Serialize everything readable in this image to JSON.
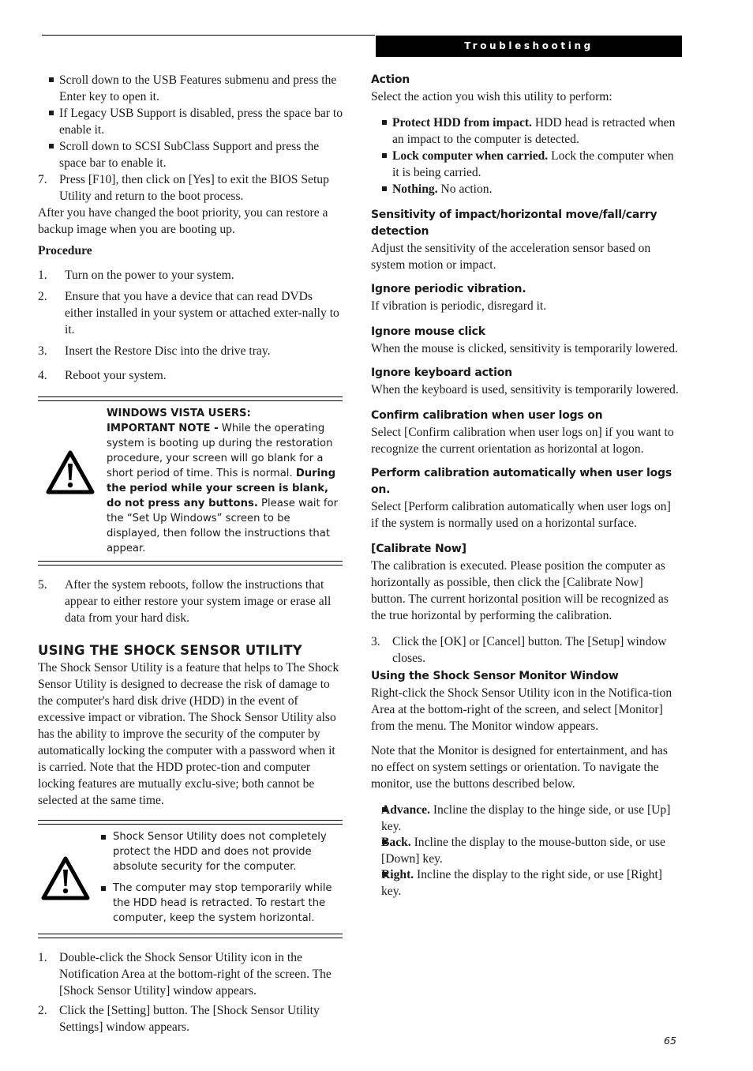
{
  "header": {
    "section_banner": "Troubleshooting"
  },
  "left": {
    "bios_bullets": [
      "Scroll down to the USB Features submenu and press the Enter key to open it.",
      "If Legacy USB Support is disabled, press the space bar to enable it.",
      "Scroll down to SCSI SubClass Support and press the space bar to enable it."
    ],
    "step7": {
      "num": "7.",
      "text": "Press [F10], then click on [Yes] to exit the BIOS Setup Utility and return to the boot process."
    },
    "after_text": "After you have changed the boot priority, you can restore a backup image when you are booting up.",
    "procedure_label": "Procedure",
    "procedure_steps": [
      {
        "num": "1.",
        "text": "Turn on the power to your system."
      },
      {
        "num": "2.",
        "text": "Ensure that you have a device that can read DVDs either installed in your system or attached exter-nally to it."
      },
      {
        "num": "3.",
        "text": "Insert the Restore Disc into the drive tray."
      },
      {
        "num": "4.",
        "text": "Reboot your system."
      }
    ],
    "vista_note": {
      "icon": "warning-icon",
      "heading": "WINDOWS VISTA USERS:",
      "lead_bold": "IMPORTANT NOTE -",
      "text1": " While the operating system is booting up during the restoration procedure, your screen will go blank for a short period of time. This is normal. ",
      "bold2": "During the period while your screen is blank, do not press any buttons.",
      "text2": " Please wait for the “Set Up Windows” screen to be displayed, then follow the instructions that appear."
    },
    "step5": {
      "num": "5.",
      "text": "After the system reboots, follow the instructions that appear to either restore your system image or erase all data from your hard disk."
    },
    "shock_title": "USING THE SHOCK SENSOR UTILITY",
    "shock_intro": "The Shock Sensor Utility is a feature that helps to The Shock Sensor Utility is designed to decrease the risk of damage to the computer's hard disk drive (HDD) in the event of excessive impact or vibration. The Shock Sensor Utility also has the ability to improve the security of the computer by automatically locking the computer with a password when it is carried. Note that the HDD protec-tion and computer locking features are mutually exclu-sive; both cannot be selected at the same time.",
    "shock_note": {
      "icon": "warning-icon",
      "bullets": [
        "Shock Sensor Utility does not completely protect the HDD and does not provide absolute security for the computer.",
        "The computer may stop temporarily while the HDD head is retracted. To restart the computer, keep the system horizontal."
      ]
    },
    "shock_steps": [
      {
        "num": "1.",
        "text": "Double-click the Shock Sensor Utility icon in the Notification Area at the bottom-right of the screen. The [Shock Sensor Utility] window appears."
      },
      {
        "num": "2.",
        "text": "Click the [Setting] button. The [Shock Sensor Utility Settings] window appears."
      }
    ]
  },
  "right": {
    "action_heading": "Action",
    "action_intro": "Select the action you wish this utility to perform:",
    "action_bullets": [
      {
        "bold": "Protect HDD from impact.",
        "text": " HDD head is retracted when an impact to the computer is detected."
      },
      {
        "bold": "Lock computer when carried.",
        "text": " Lock the computer when it is being carried."
      },
      {
        "bold": "Nothing.",
        "text": " No action."
      }
    ],
    "settings": [
      {
        "heading": "Sensitivity of impact/horizontal move/fall/carry detection",
        "text": "Adjust the sensitivity of the acceleration sensor based on system motion or impact."
      },
      {
        "heading": "Ignore periodic vibration.",
        "text": "If vibration is periodic, disregard it."
      },
      {
        "heading": "Ignore mouse click",
        "text": "When the mouse is clicked, sensitivity is temporarily lowered."
      },
      {
        "heading": "Ignore keyboard action",
        "text": "When the keyboard is used, sensitivity is temporarily lowered."
      },
      {
        "heading": "Confirm calibration when user logs on",
        "text": "Select [Confirm calibration when user logs on] if you want to recognize the current orientation as horizontal at logon."
      },
      {
        "heading": "Perform calibration automatically when user logs on.",
        "text": "Select [Perform calibration automatically when user logs on] if the system is normally used on a horizontal surface."
      },
      {
        "heading": "[Calibrate Now]",
        "text": "The calibration is executed. Please position the computer as horizontally as possible, then click the [Calibrate Now] button. The current horizontal position will be recognized as the true horizontal by performing the calibration."
      }
    ],
    "step3": {
      "num": "3.",
      "text": "Click the [OK] or [Cancel] button. The [Setup] window closes."
    },
    "monitor_heading": "Using the Shock Sensor Monitor Window",
    "monitor_text1": "Right-click the Shock Sensor Utility icon in the Notifica-tion Area at the bottom-right of the screen, and select [Monitor] from the menu. The Monitor window appears.",
    "monitor_text2": "Note that the Monitor is designed for entertainment, and has no effect on system settings or orientation. To navigate the monitor, use the buttons described below.",
    "monitor_bullets": [
      {
        "bold": "Advance.",
        "text": " Incline the display to the hinge side, or use [Up] key."
      },
      {
        "bold": "Back.",
        "text": " Incline the display to the mouse-button side, or use [Down] key."
      },
      {
        "bold": "Right.",
        "text": " Incline the display to the right side, or use [Right] key."
      }
    ]
  },
  "footer": {
    "page_number": "65"
  }
}
